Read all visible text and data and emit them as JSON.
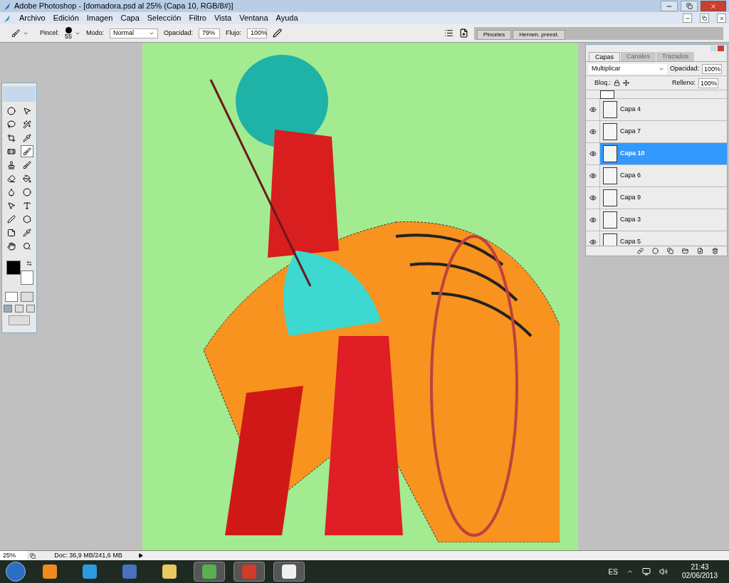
{
  "window": {
    "title": "Adobe Photoshop - [domadora.psd al 25% (Capa 10, RGB/8#)]"
  },
  "menu": [
    "Archivo",
    "Edición",
    "Imagen",
    "Capa",
    "Selección",
    "Filtro",
    "Vista",
    "Ventana",
    "Ayuda"
  ],
  "options_bar": {
    "brush_label": "Pincel:",
    "brush_size": "55",
    "mode_label": "Modo:",
    "mode": "Normal",
    "opacity_label": "Opacidad:",
    "opacity": "79%",
    "flow_label": "Flujo:",
    "flow": "100%"
  },
  "palette_well": [
    {
      "label": "Pinceles",
      "selected": false
    },
    {
      "label": "Herram. preest.",
      "selected": false
    }
  ],
  "layers_panel": {
    "tabs": [
      {
        "label": "Capas",
        "selected": true
      },
      {
        "label": "Canales",
        "selected": false
      },
      {
        "label": "Trazados",
        "selected": false
      }
    ],
    "blend_mode": "Multiplicar",
    "opacity_label": "Opacidad:",
    "opacity": "100%",
    "lock_label": "Bloq.:",
    "fill_label": "Relleno:",
    "fill": "100%",
    "layers": [
      {
        "name": "Capa 4",
        "visible": true,
        "selected": false
      },
      {
        "name": "Capa 7",
        "visible": true,
        "selected": false
      },
      {
        "name": "Capa 10",
        "visible": true,
        "selected": true
      },
      {
        "name": "Capa 6",
        "visible": true,
        "selected": false
      },
      {
        "name": "Capa 9",
        "visible": true,
        "selected": false
      },
      {
        "name": "Capa 3",
        "visible": true,
        "selected": false
      },
      {
        "name": "Capa 5",
        "visible": true,
        "selected": false
      }
    ]
  },
  "status_bar": {
    "zoom": "25%",
    "doc": "Doc: 36,9 MB/241,6 MB"
  },
  "taskbar": {
    "language": "ES",
    "time": "21:43",
    "date": "02/06/2013"
  }
}
